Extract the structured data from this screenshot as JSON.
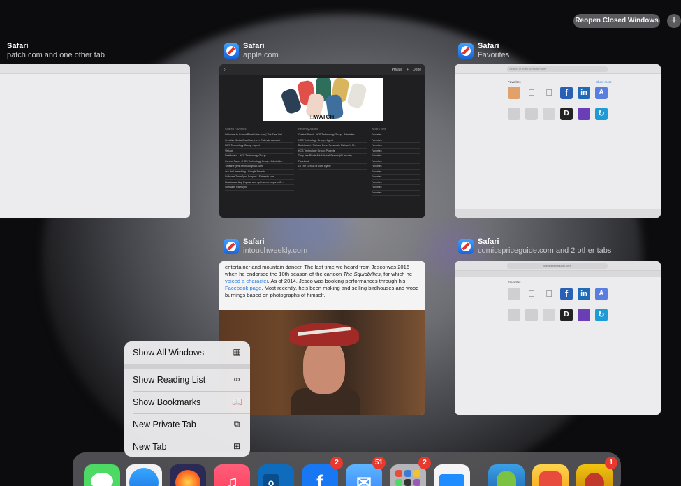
{
  "topbar": {
    "reopen_label": "Reopen Closed Windows",
    "add_icon": "+"
  },
  "windows": [
    {
      "app": "Safari",
      "subtitle": "patch.com and one other tab"
    },
    {
      "app": "Safari",
      "subtitle": "apple.com"
    },
    {
      "app": "Safari",
      "subtitle": "Favorites"
    },
    {
      "app": "Safari",
      "subtitle": "intouchweekly.com"
    },
    {
      "app": "Safari",
      "subtitle": "comicspriceguide.com and 2 other tabs"
    }
  ],
  "apple_thumb": {
    "toolbar_right": [
      "Private",
      "+",
      "Done"
    ],
    "watch_label": "WATCH",
    "col_headers": [
      "Shared Favorites",
      "Recently Added",
      "What's New"
    ],
    "col1": [
      "Welcome to ComicsPriceGuide.com | The Free Onl...",
      "Creative Media Graphics, Inc. > Estimate Account",
      "HCS Technology Group - Agent",
      "Verizon",
      "Dashboard - HCS Technology Group",
      "Control Panel - HCS Technology Group - Administr...",
      "Timeline (time.technologroup.com)",
      "use find-refreshing - Google Search",
      "Software TeamSync Support - Entrends.com",
      "How to use App Expose and split-screen apps in iP...",
      "Software TeamSync"
    ],
    "col2": [
      "Control Panel - HCS Technology Group - Administr...",
      "HCS Technology Group - Agent",
      "Dashboard - Richard Dunn Personal - Richard's M...",
      "HCS Technology Group: Projects",
      "They use Rivals Adult Model Search (All results)",
      "Facebook",
      "10 The Genius of John Byrne"
    ],
    "col3": [
      "Favorites",
      "Favorites",
      "Favorites",
      "Favorites",
      "Favorites",
      "Favorites",
      "Favorites",
      "Favorites",
      "Favorites",
      "Favorites",
      "Favorites",
      "Favorites"
    ]
  },
  "favorites_thumb": {
    "address_placeholder": "Search or enter website name",
    "section": "Favorites",
    "show_more": "Show more"
  },
  "article_thumb": {
    "text_lead": "entertainer and mountain dancer. The last time we heard from Jesco was 2016 when he endorsed the 10th season of the cartoon ",
    "text_italic": "The Squidbillies",
    "text_mid": ", for which he ",
    "text_link1": "voiced a character",
    "text_mid2": ". As of 2014, Jesco was booking performances through his ",
    "text_link2": "Facebook page",
    "text_end": ". Most recently, he's been making and selling birdhouses and wood burnings based on photographs of himself."
  },
  "comics_thumb": {
    "url": "comicspriceguide.com",
    "section": "Favorites"
  },
  "context_menu": {
    "items": [
      {
        "label": "Show All Windows",
        "icon": "grid-icon"
      },
      {
        "label": "Show Reading List",
        "icon": "glasses-icon"
      },
      {
        "label": "Show Bookmarks",
        "icon": "book-icon"
      },
      {
        "label": "New Private Tab",
        "icon": "private-tab-icon"
      },
      {
        "label": "New Tab",
        "icon": "new-tab-icon"
      }
    ]
  },
  "dock": {
    "badges": {
      "facebook": "2",
      "mail": "51",
      "folder": "2",
      "clash": "1"
    },
    "colors": {
      "messages": "#4cd964",
      "safari": "#2f8cff",
      "firefox": "#ff6a1f",
      "music": "#fc3c5a",
      "outlook": "#0f6cbd",
      "facebook": "#1877f2",
      "mail": "#3a8fff",
      "files": "#1f8cff"
    }
  }
}
